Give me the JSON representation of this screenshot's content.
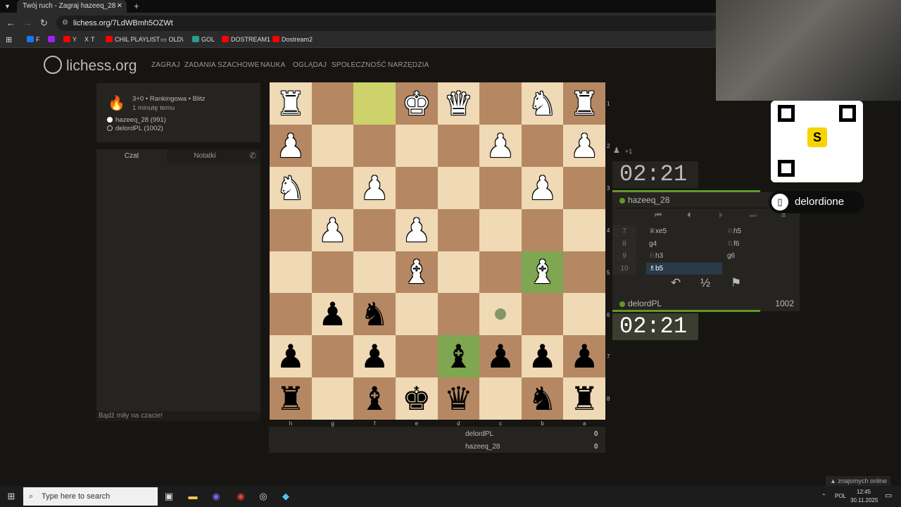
{
  "browser": {
    "tab_title": "Twój ruch - Zagraj hazeeq_28 -",
    "url": "lichess.org/7LdWBmh5OZWt",
    "bookmarks": [
      {
        "label": "F",
        "color": "#1877f2"
      },
      {
        "label": "Y",
        "color": "#ff0000"
      },
      {
        "label": "T",
        "color": "#000000"
      },
      {
        "label": "CHIL PLAYLIST",
        "color": "#ff0000"
      },
      {
        "label": "OLD\\",
        "color": "#888888"
      },
      {
        "label": "GOL",
        "color": "#2a9d8f"
      },
      {
        "label": "DOSTREAM1",
        "color": "#ff0000"
      },
      {
        "label": "Dostream2",
        "color": "#ff0000"
      }
    ]
  },
  "site": {
    "logo": "lichess.org",
    "menu": [
      "ZAGRAJ",
      "ZADANIA SZACHOWE",
      "NAUKA",
      "OGLĄDAJ",
      "SPOŁECZNOŚĆ",
      "NARZĘDZIA"
    ]
  },
  "game_info": {
    "title": "3+0 • Rankingowa • Blitz",
    "time": "1 minutę temu",
    "white": "hazeeq_28 (991)",
    "black": "delordPL (1002)"
  },
  "chat": {
    "tab_chat": "Czat",
    "tab_notes": "Notatki",
    "placeholder": "Bądź miły na czacie!"
  },
  "board": {
    "orientation": "black",
    "rows": [
      [
        "wR",
        "",
        "",
        "wK",
        "wQ",
        "",
        "wN",
        "wR"
      ],
      [
        "wP",
        "",
        "",
        "",
        "",
        "wP",
        "",
        "wP"
      ],
      [
        "wN",
        "",
        "wP",
        "",
        "",
        "",
        "wP",
        ""
      ],
      [
        "",
        "wP",
        "",
        "wP",
        "",
        "",
        "",
        ""
      ],
      [
        "",
        "",
        "",
        "wB",
        "",
        "",
        "wB",
        ""
      ],
      [
        "",
        "bP",
        "bN",
        "",
        "",
        "",
        "",
        ""
      ],
      [
        "bP",
        "",
        "bP",
        "",
        "bB",
        "bP",
        "bP",
        "bP"
      ],
      [
        "bR",
        "",
        "bB",
        "bK",
        "bQ",
        "",
        "bN",
        "bR"
      ]
    ],
    "highlight_light": [
      [
        0,
        2
      ]
    ],
    "highlight_green": [
      [
        6,
        4
      ],
      [
        4,
        6
      ]
    ],
    "move_dot": [
      [
        5,
        5
      ]
    ],
    "ranks": [
      "1",
      "2",
      "3",
      "4",
      "5",
      "6",
      "7",
      "8"
    ],
    "files": [
      "h",
      "g",
      "f",
      "e",
      "d",
      "c",
      "b",
      "a"
    ]
  },
  "material": {
    "rows": [
      {
        "name": "delordPL",
        "score": "0"
      },
      {
        "name": "hazeeq_28",
        "score": "0"
      }
    ]
  },
  "opponent": {
    "name": "hazeeq_28",
    "clock": "02:21",
    "captured": "+1"
  },
  "player": {
    "name": "delordPL",
    "rating": "1002",
    "clock": "02:21"
  },
  "moves": [
    {
      "num": "7",
      "white": "♕xe5",
      "black": "♘h5",
      "current": false
    },
    {
      "num": "8",
      "white": "g4",
      "black": "♘f6",
      "current": false
    },
    {
      "num": "9",
      "white": "♘h3",
      "black": "g6",
      "current": false
    },
    {
      "num": "10",
      "white": "♗b5",
      "black": "",
      "current": true
    }
  ],
  "stream": {
    "handle": "delordione",
    "qr_logo": "S"
  },
  "taskbar": {
    "search": "Type here to search",
    "lang": "POL",
    "time": "12:45",
    "date": "30.11.2025",
    "friends": "znajomych online"
  }
}
